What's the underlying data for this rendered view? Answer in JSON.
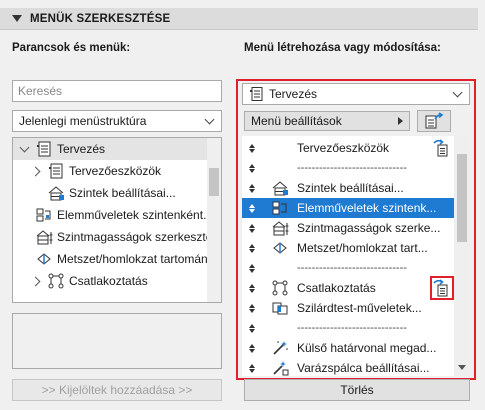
{
  "section": {
    "title": "MENÜK SZERKESZTÉSE"
  },
  "left": {
    "label": "Parancsok és menük:",
    "search_placeholder": "Keresés",
    "structure_select": "Jelenlegi menüstruktúra",
    "tree": [
      {
        "label": "Tervezés",
        "expander": "down",
        "icon": "menu-list-icon",
        "level": 0,
        "selected": true
      },
      {
        "label": "Tervezőeszközök",
        "expander": "right",
        "icon": "menu-list-icon",
        "level": 1
      },
      {
        "label": "Szintek beállításai...",
        "expander": "",
        "icon": "story-settings-icon",
        "level": 1
      },
      {
        "label": "Elemműveletek szintenként...",
        "expander": "",
        "icon": "element-operations-icon",
        "level": 1
      },
      {
        "label": "Szintmagasságok szerkesztése...",
        "expander": "",
        "icon": "story-heights-icon",
        "level": 1
      },
      {
        "label": "Metszet/homlokzat tartomány...",
        "expander": "",
        "icon": "section-elevation-icon",
        "level": 1
      },
      {
        "label": "Csatlakoztatás",
        "expander": "right",
        "icon": "connection-icon",
        "level": 1
      }
    ],
    "add_button": ">> Kijelöltek hozzáadása >>"
  },
  "right": {
    "label": "Menü létrehozása vagy módosítása:",
    "menu_select": "Tervezés",
    "menu_settings": "Menü beállítások",
    "items": [
      {
        "type": "item",
        "label": "Tervezőeszközök",
        "icon": "",
        "badge": true
      },
      {
        "type": "separator",
        "label": "------------------------------"
      },
      {
        "type": "item",
        "label": "Szintek beállításai...",
        "icon": "story-settings-icon"
      },
      {
        "type": "item",
        "label": "Elemműveletek szintenk...",
        "icon": "element-operations-icon",
        "selected": true
      },
      {
        "type": "item",
        "label": "Szintmagasságok szerke...",
        "icon": "story-heights-icon"
      },
      {
        "type": "item",
        "label": "Metszet/homlokzat tart...",
        "icon": "section-elevation-icon"
      },
      {
        "type": "separator",
        "label": "------------------------------"
      },
      {
        "type": "item",
        "label": "Csatlakoztatás",
        "icon": "connection-icon",
        "badge": true
      },
      {
        "type": "item",
        "label": "Szilárdtest-műveletek...",
        "icon": "solid-operations-icon"
      },
      {
        "type": "separator",
        "label": "------------------------------"
      },
      {
        "type": "item",
        "label": "Külső határvonal megad...",
        "icon": "magic-wand-icon"
      },
      {
        "type": "item",
        "label": "Varázspálca beállításai...",
        "icon": "magic-wand-settings-icon"
      }
    ],
    "delete_button": "Törlés"
  },
  "colors": {
    "selection": "#1f7ad1",
    "highlight_frame": "#e0202a",
    "panel_bg": "#f0f0f0"
  }
}
